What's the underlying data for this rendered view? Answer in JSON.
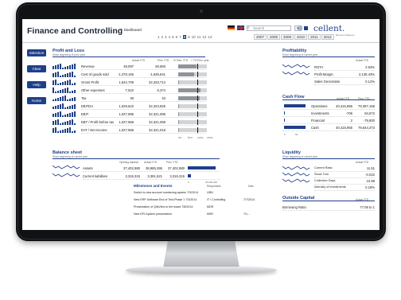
{
  "app": {
    "title": "Finance and Controlling",
    "dashboard_label": "Dashboard"
  },
  "periods": {
    "months": [
      "1",
      "2",
      "3",
      "4",
      "5",
      "6",
      "7",
      "8",
      "9",
      "10",
      "11",
      "12",
      "13"
    ],
    "selected_month": "8",
    "years": [
      "2007",
      "2008",
      "2009",
      "2010",
      "2011",
      "2012"
    ]
  },
  "header": {
    "search_placeholder": "Search",
    "icon_buttons": [
      "chevron-down-icon",
      "help-icon",
      "print-icon"
    ]
  },
  "logo": {
    "name": "cellent.",
    "tagline": "Business Intelligence",
    "colors": [
      "#1f3f8a",
      "#9fb6d9"
    ]
  },
  "sidebar": {
    "buttons": [
      "Selection",
      "Clear",
      "Help",
      "Home"
    ]
  },
  "colors": {
    "accent": "#1f3f8a",
    "bar_gray": "#8f949a",
    "track_gray": "#d2d4d7"
  },
  "profit_loss": {
    "title": "Profit and Loss",
    "subtitle": "Since beginning of prev. year",
    "col_actual": "Actual YTD",
    "col_prev": "Prev. YTD",
    "legend_labels": [
      "% Prev. YTD",
      "> 7% Prev. year"
    ],
    "axis_ticks": [
      "0%",
      "50%",
      "100%",
      "150%"
    ],
    "rows": [
      {
        "label": "Revenue",
        "actual": "49,097",
        "prev": "50,683",
        "pct": 0.97,
        "target": 1.0
      },
      {
        "label": "Cost of goods sold",
        "actual": "-1,378,165",
        "prev": "-1,635,641",
        "pct": 0.84,
        "target": 1.0
      },
      {
        "label": "Gross Profit",
        "actual": "1,642,709",
        "prev": "32,333,714",
        "pct": 0.05,
        "target": 1.0
      },
      {
        "label": "Other expenses",
        "actual": "7,522",
        "prev": "6,374",
        "pct": 1.18,
        "target": 1.0
      },
      {
        "label": "Tax",
        "actual": "48",
        "prev": "43",
        "pct": 1.12,
        "target": 1.0
      },
      {
        "label": "EBITDA",
        "actual": "1,029,623",
        "prev": "32,323,826",
        "pct": 0.03,
        "target": 1.0
      },
      {
        "label": "EBIT",
        "actual": "1,027,995",
        "prev": "32,321,085",
        "pct": 0.03,
        "target": 1.0
      },
      {
        "label": "EBT / Profit before tax",
        "actual": "1,027,958",
        "prev": "32,321,059",
        "pct": 0.03,
        "target": 1.0
      },
      {
        "label": "EAT / Net Income",
        "actual": "1,027,958",
        "prev": "32,321,018",
        "pct": 0.03,
        "target": 1.0
      }
    ]
  },
  "profitability": {
    "title": "Profitability",
    "subtitle": "Since beginning of current year",
    "col_actual": "Actual YTD",
    "rows": [
      {
        "label": "ROTA",
        "value": "2.63%"
      },
      {
        "label": "Profit Margin",
        "value": "2,135.43%"
      },
      {
        "label": "Sales Generation",
        "value": "0.12%"
      }
    ]
  },
  "cash_flow": {
    "title": "Cash Flow",
    "col_actual": "Actual YTD",
    "col_prev": "Prev. YTD",
    "axis_ticks": [
      "0",
      "50"
    ],
    "rows": [
      {
        "label": "Operations",
        "actual": "40,415,955",
        "prev": "79,397,168",
        "bar": 0.9
      },
      {
        "label": "Investments",
        "actual": "-706",
        "prev": "84,672",
        "bar": 0.02
      },
      {
        "label": "Financial",
        "actual": "2",
        "prev": "-79,800",
        "bar": 0.01
      },
      {
        "label": "Cash",
        "actual": "40,415,955",
        "prev": "79,644,373",
        "bar": 0.9
      }
    ]
  },
  "balance_sheet": {
    "title": "Balance sheet",
    "subtitle": "Since beginning of current year",
    "col_opening": "Opening balance",
    "col_actual": "Actual YTD",
    "col_prev": "Prev. YTD",
    "axis_ticks": [
      "0",
      "30,000,000"
    ],
    "rows": [
      {
        "label": "Assets",
        "opening": "37,402,980",
        "actual": "38,985,395",
        "prev": "37,402,980",
        "bar": 0.92
      },
      {
        "label": "Current liabilities",
        "opening": "3,316,315",
        "actual": "3,391,521",
        "prev": "3,316,315",
        "bar": 0.1
      }
    ]
  },
  "milestones": {
    "title": "Milestones and Events",
    "col_responsible": "Responsible",
    "col_date": "Date",
    "rows": [
      {
        "text": "Switch to new account numbering system 7/3/2014",
        "responsible": "UBN",
        "date": ""
      },
      {
        "text": "New ERP-Software End of Test-Phase 1 7/3/2014",
        "responsible": "IT / Controlling",
        "date": "7/7/2014"
      },
      {
        "text": "Presentation of QlikView to the board 7/8/2014",
        "responsible": "MDR",
        "date": ""
      },
      {
        "text": "New KPI-System presentation",
        "responsible": "MSR",
        "date": "7/1..."
      }
    ]
  },
  "liquidity": {
    "title": "Liquidity",
    "subtitle": "Since beginning of current year",
    "col_actual": "Actual YTD",
    "rows": [
      {
        "label": "Current Ratio",
        "value": "11.51"
      },
      {
        "label": "Stock Turn",
        "value": "-0.022"
      },
      {
        "label": "Collection Days",
        "value": "10.88"
      },
      {
        "label": "Intensity of investments",
        "value": "0.18%"
      }
    ]
  },
  "outside_capital": {
    "title": "Outside Capital",
    "col_actual": "Actual YTD",
    "rows": [
      {
        "label": "Borrowing Ratio",
        "value": "77.08 to 1"
      }
    ]
  }
}
